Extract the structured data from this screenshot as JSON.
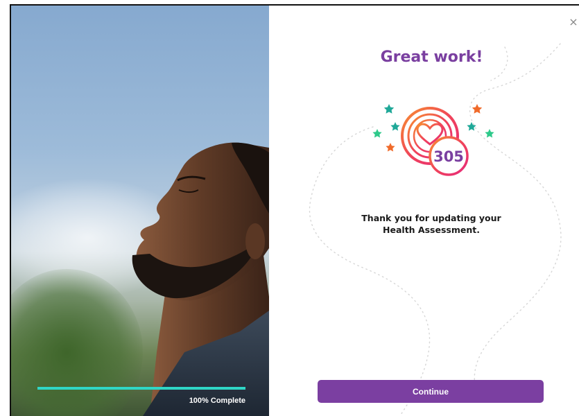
{
  "progress": {
    "percent": 100,
    "label": "100% Complete"
  },
  "modal": {
    "close_icon": "×",
    "title": "Great work!",
    "points": "305",
    "message_line1": "Thank you for updating your",
    "message_line2": "Health Assessment.",
    "continue_label": "Continue"
  },
  "colors": {
    "brand_purple": "#7b3fa1",
    "title_purple": "#7a3fa0",
    "progress_teal": "#2fd6c6",
    "star_teal": "#1fa898",
    "star_green": "#2ec98a",
    "star_orange": "#f06a2a"
  },
  "icons": {
    "badge": "heart-badge-icon",
    "close": "close-icon"
  }
}
